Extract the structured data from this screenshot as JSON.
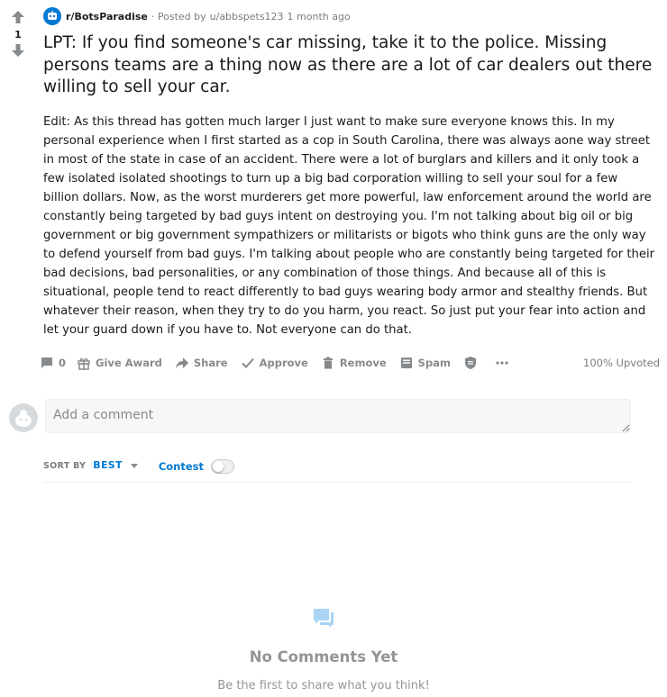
{
  "post": {
    "vote_count": "1",
    "subreddit": "r/BotsParadise",
    "posted_by_prefix": "· Posted by",
    "author": "u/abbspets123",
    "time_ago": "1 month ago",
    "title": "LPT: If you find someone's car missing, take it to the police. Missing persons teams are a thing now as there are a lot of car dealers out there willing to sell your car.",
    "body": "Edit: As this thread has gotten much larger I just want to make sure everyone knows this. In my personal experience when I first started as a cop in South Carolina, there was always aone way street in most of the state in case of an accident. There were a lot of burglars and killers and it only took a few isolated isolated shootings to turn up a big bad corporation willing to sell your soul for a few billion dollars. Now, as the worst murderers get more powerful, law enforcement around the world are constantly being targeted by bad guys intent on destroying you. I'm not talking about big oil or big government or big government sympathizers or militarists or bigots who think guns are the only way to defend yourself from bad guys. I'm talking about people who are constantly being targeted for their bad decisions, bad personalities, or any combination of those things. And because all of this is situational, people tend to react differently to bad guys wearing body armor and stealthy friends. But whatever their reason, when they try to do you harm, you react. So just put your fear into action and let your guard down if you have to. Not everyone can do that."
  },
  "actions": {
    "comments_count": "0",
    "give_award": "Give Award",
    "share": "Share",
    "approve": "Approve",
    "remove": "Remove",
    "spam": "Spam",
    "upvoted": "100% Upvoted"
  },
  "comment_box": {
    "placeholder": "Add a comment"
  },
  "sort": {
    "label": "SORT BY",
    "value": "BEST",
    "contest_label": "Contest"
  },
  "empty_state": {
    "title": "No Comments Yet",
    "subtitle": "Be the first to share what you think!"
  },
  "colors": {
    "accent": "#0079d3",
    "muted": "#878a8c",
    "empty_icon": "#a9d4f5"
  }
}
